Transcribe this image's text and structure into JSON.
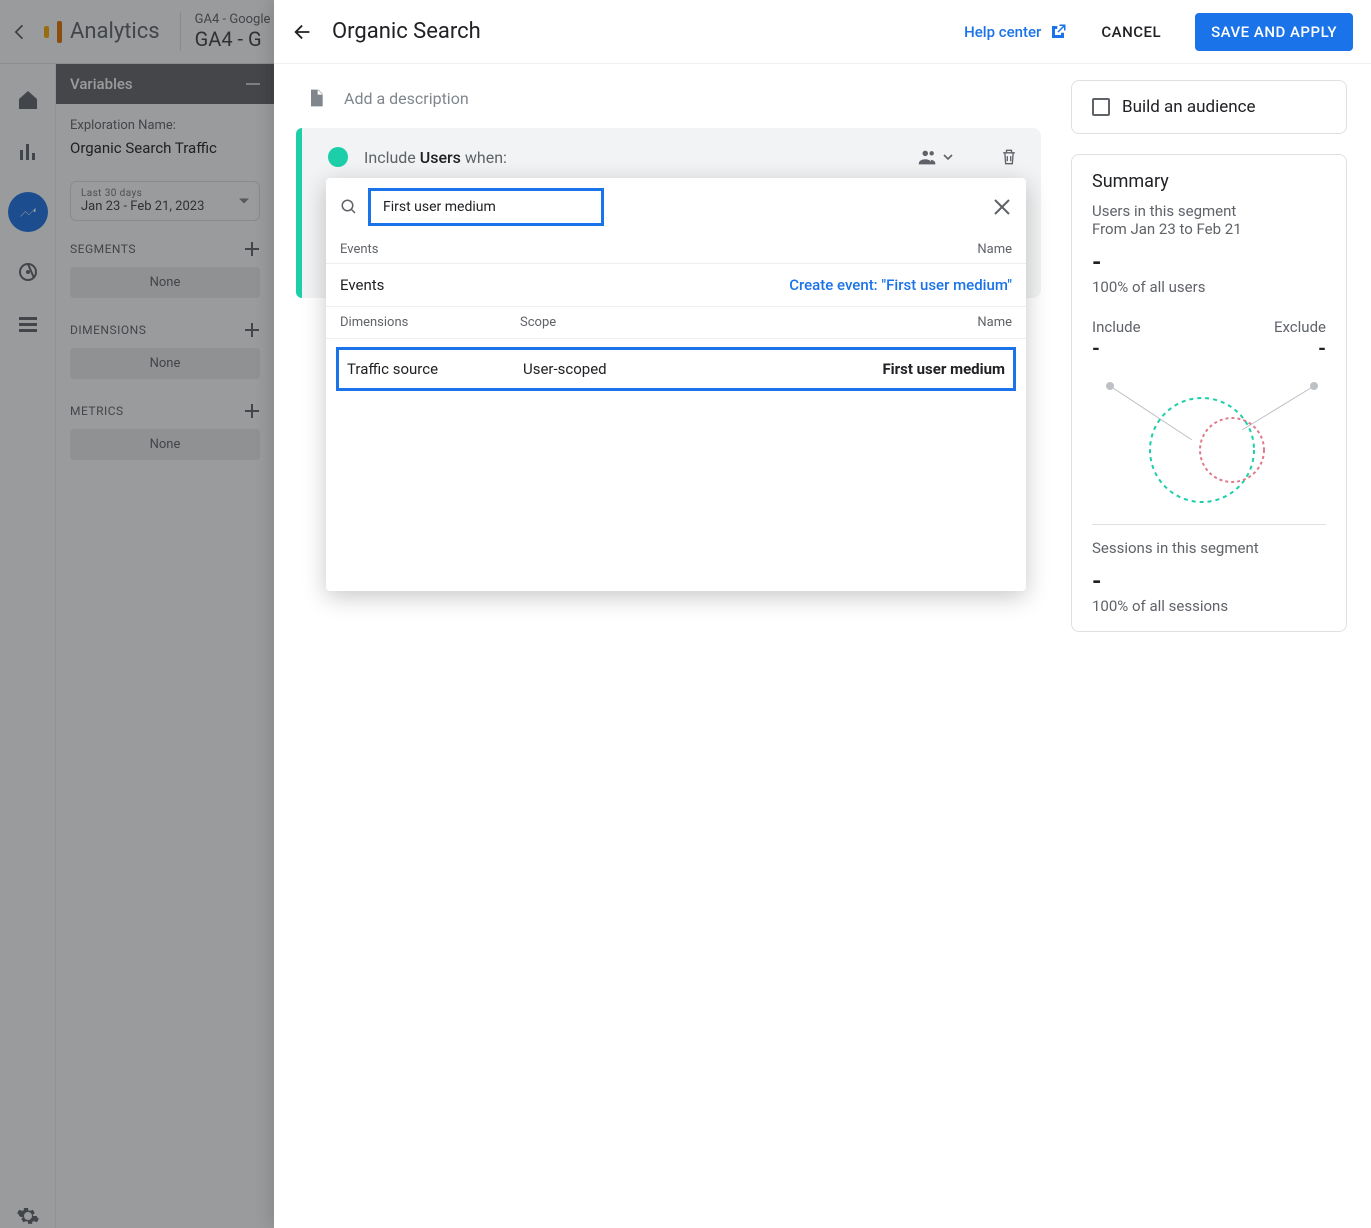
{
  "topbar": {
    "product": "Analytics",
    "property_line1": "GA4 - Google",
    "property_line2": "GA4 - G"
  },
  "variables": {
    "panel_title": "Variables",
    "exploration_name_label": "Exploration Name:",
    "exploration_name_value": "Organic Search Traffic",
    "date_range_label": "Last 30 days",
    "date_range_value": "Jan 23 - Feb 21, 2023",
    "segments_label": "SEGMENTS",
    "segments_none": "None",
    "dimensions_label": "DIMENSIONS",
    "dimensions_none": "None",
    "metrics_label": "METRICS",
    "metrics_none": "None"
  },
  "modal": {
    "title": "Organic Search",
    "help_center": "Help center",
    "cancel": "CANCEL",
    "save": "SAVE AND APPLY",
    "desc_placeholder": "Add a description",
    "include_prefix": "Include ",
    "include_subject": "Users",
    "include_suffix": " when:"
  },
  "popover": {
    "search_value": "First user medium",
    "events_header_left": "Events",
    "events_header_right": "Name",
    "events_row_left": "Events",
    "create_event_link": "Create event: \"First user medium\"",
    "dims_header_a": "Dimensions",
    "dims_header_b": "Scope",
    "dims_header_c": "Name",
    "dim_a": "Traffic source",
    "dim_b": "User-scoped",
    "dim_c": "First user medium"
  },
  "right": {
    "build_audience": "Build an audience",
    "summary_title": "Summary",
    "users_line1": "Users in this segment",
    "users_line2": "From Jan 23 to Feb 21",
    "dash": "-",
    "pct_users": "100% of all users",
    "include_label": "Include",
    "exclude_label": "Exclude",
    "include_val": "-",
    "exclude_val": "-",
    "sessions_line": "Sessions in this segment",
    "pct_sessions": "100% of all sessions"
  }
}
